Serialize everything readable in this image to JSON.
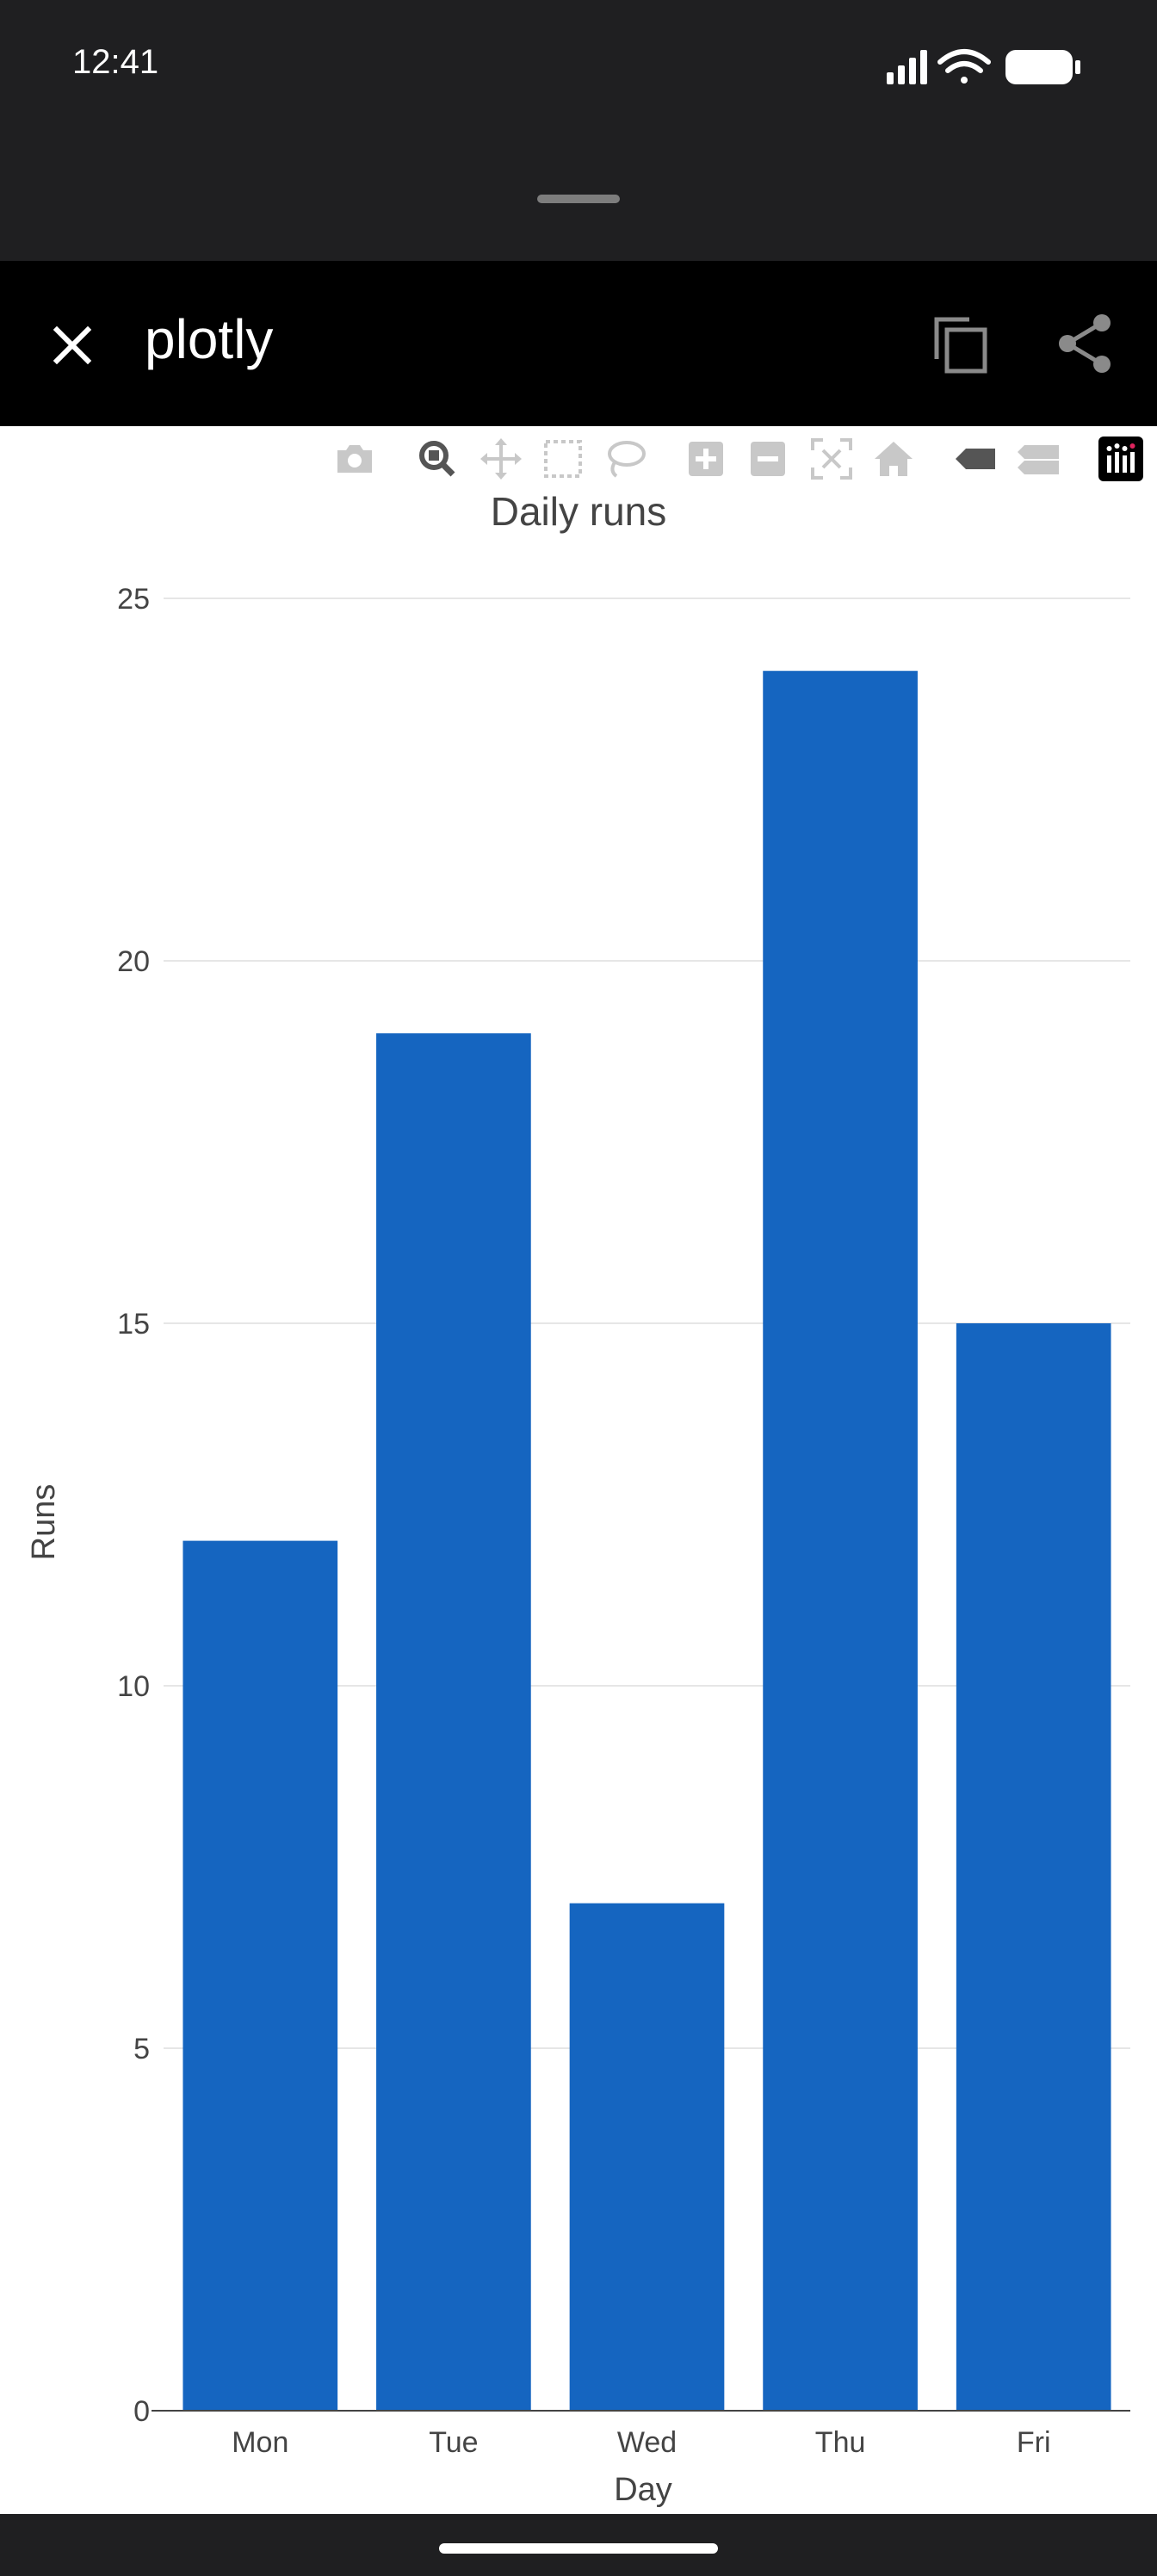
{
  "status_bar": {
    "time": "12:41",
    "icons": [
      "signal-icon",
      "wifi-icon",
      "battery-icon"
    ]
  },
  "app_bar": {
    "title": "plotly",
    "close_icon": "close-icon",
    "copy_icon": "copy-icon",
    "share_icon": "share-icon"
  },
  "modebar": {
    "buttons": [
      "camera-icon",
      "zoom-icon",
      "pan-icon",
      "box-select-icon",
      "lasso-icon",
      "zoom-in-icon",
      "zoom-out-icon",
      "autoscale-icon",
      "reset-axes-icon",
      "spike-lines-icon",
      "compare-hover-icon",
      "plotly-logo-icon"
    ]
  },
  "colors": {
    "bar": "#1565c0",
    "grid": "#e6e6e6",
    "text": "#444444"
  },
  "chart_data": {
    "type": "bar",
    "title": "Daily runs",
    "xlabel": "Day",
    "ylabel": "Runs",
    "categories": [
      "Mon",
      "Tue",
      "Wed",
      "Thu",
      "Fri"
    ],
    "values": [
      12,
      19,
      7,
      24,
      15
    ],
    "ylim": [
      0,
      25
    ],
    "yticks": [
      0,
      5,
      10,
      15,
      20,
      25
    ],
    "grid": true,
    "legend": "none"
  }
}
